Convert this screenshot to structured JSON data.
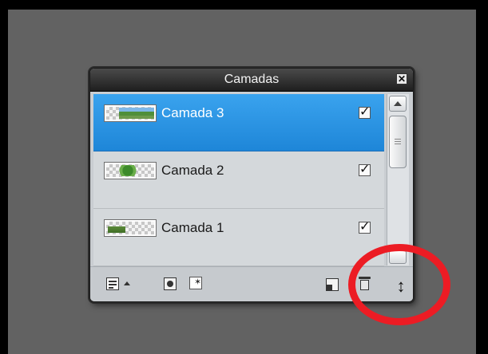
{
  "panel": {
    "title": "Camadas",
    "close_glyph": "✕"
  },
  "layers": [
    {
      "name": "Camada 3",
      "selected": true,
      "visible": true,
      "thumb": "tree-landscape"
    },
    {
      "name": "Camada 2",
      "selected": false,
      "visible": true,
      "thumb": "green-shrub"
    },
    {
      "name": "Camada 1",
      "selected": false,
      "visible": true,
      "thumb": "grass-strip"
    }
  ],
  "icons": {
    "layer_options": "layer-options-icon",
    "mask": "mask-icon",
    "effects": "effects-icon",
    "new_layer": "new-layer-icon",
    "delete_layer": "trash-icon",
    "resize": "resize-handle-icon",
    "visibility": "checkbox-icon"
  },
  "colors": {
    "selected_row": "#2a95e4",
    "highlight_circle": "#ec1c24",
    "titlebar": "#2e2e2e"
  }
}
